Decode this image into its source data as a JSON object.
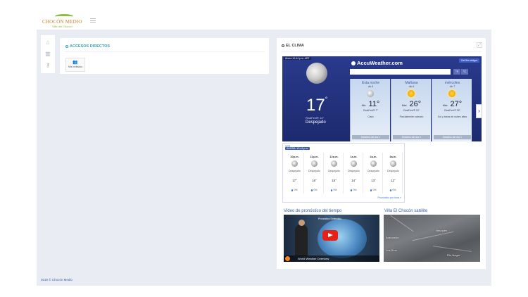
{
  "header": {
    "logo_text": "CHOCÓN MEDIO",
    "logo_sub": "Villa del Chocón"
  },
  "shortcuts": {
    "title": "ACCESOS DIRECTOS",
    "tiles": [
      {
        "label": "Mis invitados",
        "icon": "users-icon"
      }
    ]
  },
  "clima": {
    "title": "EL CLIMA",
    "current": {
      "time_label": "Ahora 10:44 p.m. ART",
      "temp": "17",
      "realfeel": "RealFeel® 14°",
      "condition": "Despejado"
    },
    "brand": "AccuWeather.com",
    "get_widget": "Get this widget",
    "units": [
      "°F",
      "°C"
    ],
    "forecast": [
      {
        "name": "Esta noche",
        "day": "dic 5",
        "prefix": "Mín.",
        "temp": "11°",
        "realfeel": "RealFeel® 7°",
        "desc": "Claro",
        "details": "Detalles del día »",
        "icon": "moon"
      },
      {
        "name": "Mañana",
        "day": "dic 6",
        "prefix": "Máx.",
        "temp": "26°",
        "realfeel": "RealFeel® 29°",
        "desc": "Parcialmente soleado",
        "details": "Detalles del día »",
        "icon": "sun"
      },
      {
        "name": "miércoles",
        "day": "dic 7",
        "prefix": "Máx.",
        "temp": "27°",
        "realfeel": "RealFeel® 28°",
        "desc": "Sol y áreas de nubes altas",
        "details": "Detalles del día »",
        "icon": "sun"
      }
    ],
    "hourly": {
      "tag": "VER",
      "now": "AHORA: 10:44 p.m.",
      "more": "Pronóstico por hora »",
      "hours": [
        {
          "time": "10p.m.",
          "cond": "Despejado",
          "temp": "17°",
          "rain": "0%"
        },
        {
          "time": "11p.m.",
          "cond": "Despejado",
          "temp": "16°",
          "rain": "0%"
        },
        {
          "time": "12a.m.",
          "cond": "Despejado",
          "temp": "15°",
          "rain": "0%"
        },
        {
          "time": "1a.m.",
          "cond": "Despejado",
          "temp": "14°",
          "rain": "0%"
        },
        {
          "time": "2a.m.",
          "cond": "Despejado",
          "temp": "13°",
          "rain": "0%"
        },
        {
          "time": "3a.m.",
          "cond": "Despejado",
          "temp": "12°",
          "rain": "0%"
        }
      ]
    },
    "video": {
      "title": "Video de pronóstico del tiempo",
      "caption": "Pronóstico Extendido",
      "name": "World Weather Overview"
    },
    "satellite": {
      "title": "Villa El Chocón satélite",
      "labels": [
        "Neuquén",
        "Araucanía",
        "Río Negro",
        "Los Ríos"
      ]
    }
  },
  "footer": {
    "text": "2016 © Chocón Medio"
  }
}
